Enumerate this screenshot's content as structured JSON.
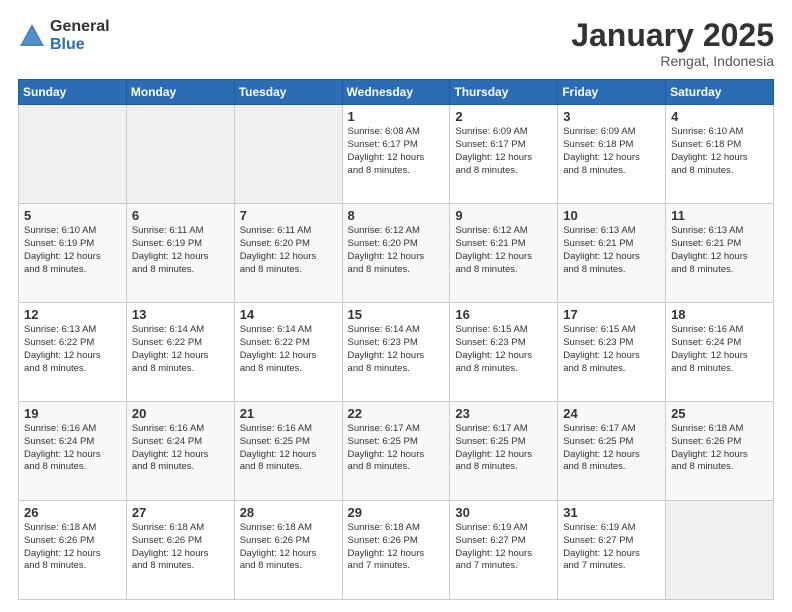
{
  "logo": {
    "general": "General",
    "blue": "Blue"
  },
  "header": {
    "month": "January 2025",
    "location": "Rengat, Indonesia"
  },
  "weekdays": [
    "Sunday",
    "Monday",
    "Tuesday",
    "Wednesday",
    "Thursday",
    "Friday",
    "Saturday"
  ],
  "weeks": [
    [
      {
        "day": "",
        "info": ""
      },
      {
        "day": "",
        "info": ""
      },
      {
        "day": "",
        "info": ""
      },
      {
        "day": "1",
        "info": "Sunrise: 6:08 AM\nSunset: 6:17 PM\nDaylight: 12 hours\nand 8 minutes."
      },
      {
        "day": "2",
        "info": "Sunrise: 6:09 AM\nSunset: 6:17 PM\nDaylight: 12 hours\nand 8 minutes."
      },
      {
        "day": "3",
        "info": "Sunrise: 6:09 AM\nSunset: 6:18 PM\nDaylight: 12 hours\nand 8 minutes."
      },
      {
        "day": "4",
        "info": "Sunrise: 6:10 AM\nSunset: 6:18 PM\nDaylight: 12 hours\nand 8 minutes."
      }
    ],
    [
      {
        "day": "5",
        "info": "Sunrise: 6:10 AM\nSunset: 6:19 PM\nDaylight: 12 hours\nand 8 minutes."
      },
      {
        "day": "6",
        "info": "Sunrise: 6:11 AM\nSunset: 6:19 PM\nDaylight: 12 hours\nand 8 minutes."
      },
      {
        "day": "7",
        "info": "Sunrise: 6:11 AM\nSunset: 6:20 PM\nDaylight: 12 hours\nand 8 minutes."
      },
      {
        "day": "8",
        "info": "Sunrise: 6:12 AM\nSunset: 6:20 PM\nDaylight: 12 hours\nand 8 minutes."
      },
      {
        "day": "9",
        "info": "Sunrise: 6:12 AM\nSunset: 6:21 PM\nDaylight: 12 hours\nand 8 minutes."
      },
      {
        "day": "10",
        "info": "Sunrise: 6:13 AM\nSunset: 6:21 PM\nDaylight: 12 hours\nand 8 minutes."
      },
      {
        "day": "11",
        "info": "Sunrise: 6:13 AM\nSunset: 6:21 PM\nDaylight: 12 hours\nand 8 minutes."
      }
    ],
    [
      {
        "day": "12",
        "info": "Sunrise: 6:13 AM\nSunset: 6:22 PM\nDaylight: 12 hours\nand 8 minutes."
      },
      {
        "day": "13",
        "info": "Sunrise: 6:14 AM\nSunset: 6:22 PM\nDaylight: 12 hours\nand 8 minutes."
      },
      {
        "day": "14",
        "info": "Sunrise: 6:14 AM\nSunset: 6:22 PM\nDaylight: 12 hours\nand 8 minutes."
      },
      {
        "day": "15",
        "info": "Sunrise: 6:14 AM\nSunset: 6:23 PM\nDaylight: 12 hours\nand 8 minutes."
      },
      {
        "day": "16",
        "info": "Sunrise: 6:15 AM\nSunset: 6:23 PM\nDaylight: 12 hours\nand 8 minutes."
      },
      {
        "day": "17",
        "info": "Sunrise: 6:15 AM\nSunset: 6:23 PM\nDaylight: 12 hours\nand 8 minutes."
      },
      {
        "day": "18",
        "info": "Sunrise: 6:16 AM\nSunset: 6:24 PM\nDaylight: 12 hours\nand 8 minutes."
      }
    ],
    [
      {
        "day": "19",
        "info": "Sunrise: 6:16 AM\nSunset: 6:24 PM\nDaylight: 12 hours\nand 8 minutes."
      },
      {
        "day": "20",
        "info": "Sunrise: 6:16 AM\nSunset: 6:24 PM\nDaylight: 12 hours\nand 8 minutes."
      },
      {
        "day": "21",
        "info": "Sunrise: 6:16 AM\nSunset: 6:25 PM\nDaylight: 12 hours\nand 8 minutes."
      },
      {
        "day": "22",
        "info": "Sunrise: 6:17 AM\nSunset: 6:25 PM\nDaylight: 12 hours\nand 8 minutes."
      },
      {
        "day": "23",
        "info": "Sunrise: 6:17 AM\nSunset: 6:25 PM\nDaylight: 12 hours\nand 8 minutes."
      },
      {
        "day": "24",
        "info": "Sunrise: 6:17 AM\nSunset: 6:25 PM\nDaylight: 12 hours\nand 8 minutes."
      },
      {
        "day": "25",
        "info": "Sunrise: 6:18 AM\nSunset: 6:26 PM\nDaylight: 12 hours\nand 8 minutes."
      }
    ],
    [
      {
        "day": "26",
        "info": "Sunrise: 6:18 AM\nSunset: 6:26 PM\nDaylight: 12 hours\nand 8 minutes."
      },
      {
        "day": "27",
        "info": "Sunrise: 6:18 AM\nSunset: 6:26 PM\nDaylight: 12 hours\nand 8 minutes."
      },
      {
        "day": "28",
        "info": "Sunrise: 6:18 AM\nSunset: 6:26 PM\nDaylight: 12 hours\nand 8 minutes."
      },
      {
        "day": "29",
        "info": "Sunrise: 6:18 AM\nSunset: 6:26 PM\nDaylight: 12 hours\nand 7 minutes."
      },
      {
        "day": "30",
        "info": "Sunrise: 6:19 AM\nSunset: 6:27 PM\nDaylight: 12 hours\nand 7 minutes."
      },
      {
        "day": "31",
        "info": "Sunrise: 6:19 AM\nSunset: 6:27 PM\nDaylight: 12 hours\nand 7 minutes."
      },
      {
        "day": "",
        "info": ""
      }
    ]
  ]
}
